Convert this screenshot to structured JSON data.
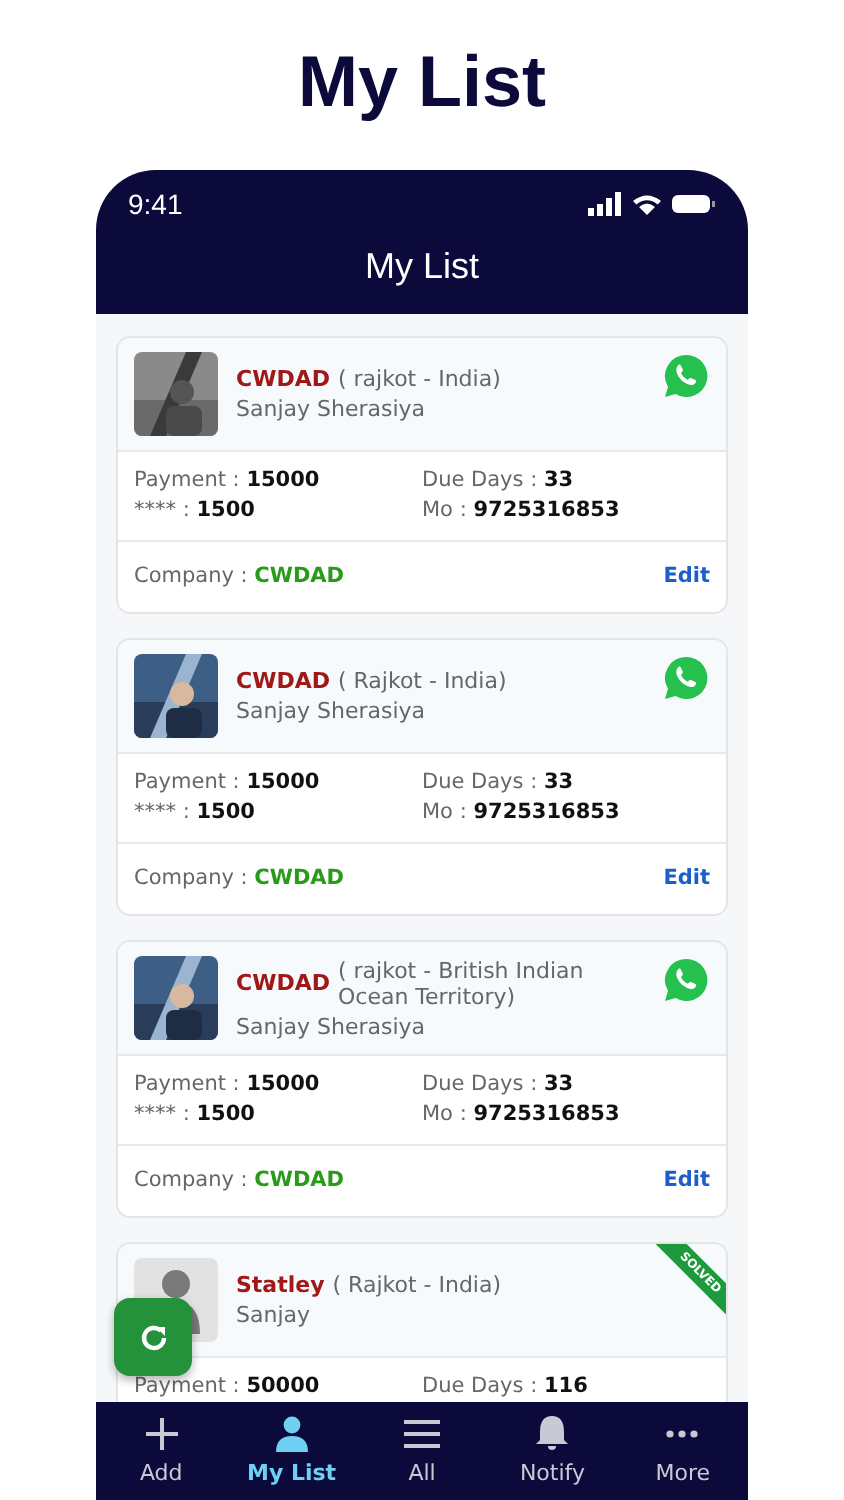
{
  "headline": "My List",
  "status_bar": {
    "time": "9:41"
  },
  "header": {
    "title": "My List"
  },
  "cards": [
    {
      "title": "CWDAD",
      "location": "( rajkot - India)",
      "person": "Sanjay Sherasiya",
      "whatsapp": true,
      "solved": false,
      "payment_label": "Payment :",
      "payment": "15000",
      "masked_label": "**** :",
      "masked": "1500",
      "due_label": "Due Days :",
      "due": "33",
      "mo_label": "Mo :",
      "mo": "9725316853",
      "company_label": "Company :",
      "company": "CWDAD",
      "edit": "Edit"
    },
    {
      "title": "CWDAD",
      "location": "( Rajkot - India)",
      "person": "Sanjay Sherasiya",
      "whatsapp": true,
      "solved": false,
      "payment_label": "Payment :",
      "payment": "15000",
      "masked_label": "**** :",
      "masked": "1500",
      "due_label": "Due Days :",
      "due": "33",
      "mo_label": "Mo :",
      "mo": "9725316853",
      "company_label": "Company :",
      "company": "CWDAD",
      "edit": "Edit"
    },
    {
      "title": "CWDAD",
      "location": "( rajkot - British Indian Ocean Territory)",
      "person": "Sanjay Sherasiya",
      "whatsapp": true,
      "solved": false,
      "payment_label": "Payment :",
      "payment": "15000",
      "masked_label": "**** :",
      "masked": "1500",
      "due_label": "Due Days :",
      "due": "33",
      "mo_label": "Mo :",
      "mo": "9725316853",
      "company_label": "Company :",
      "company": "CWDAD",
      "edit": "Edit"
    },
    {
      "avatar": {
        "kind": "placeholder"
      },
      "title": "Statley",
      "location": "( Rajkot - India)",
      "person": "Sanjay",
      "whatsapp": false,
      "solved": true,
      "solved_label": "SOLVED",
      "payment_label": "Payment :",
      "payment": "50000",
      "due_label": "Due Days :",
      "due": "116"
    }
  ],
  "nav": [
    {
      "kind": "plus",
      "label": "Add",
      "selected": false
    },
    {
      "kind": "person",
      "label": "My List",
      "selected": true
    },
    {
      "kind": "lines",
      "label": "All",
      "selected": false
    },
    {
      "kind": "bell",
      "label": "Notify",
      "selected": false
    },
    {
      "kind": "dots",
      "label": "More",
      "selected": false
    }
  ]
}
